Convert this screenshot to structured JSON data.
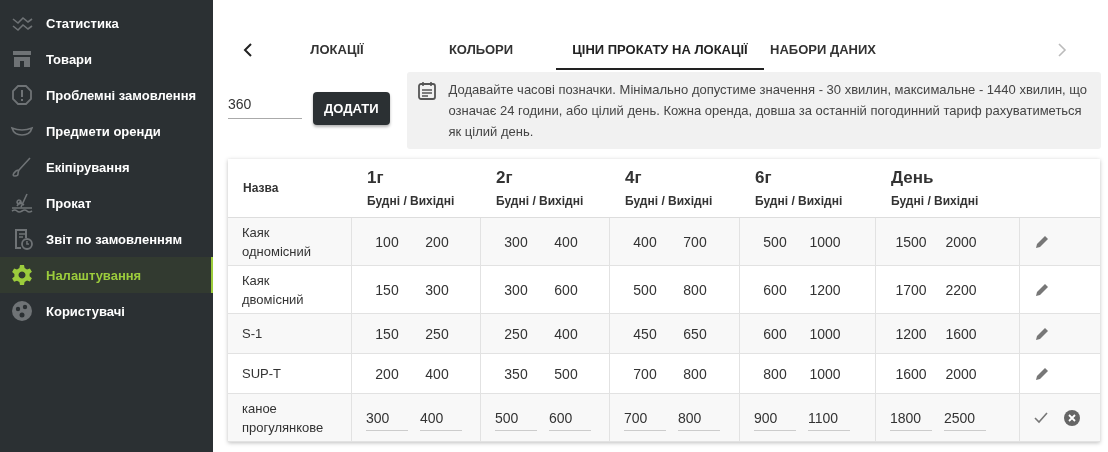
{
  "sidebar": {
    "items": [
      {
        "label": "Статистика",
        "kind": "chart",
        "selected": false
      },
      {
        "label": "Товари",
        "kind": "store",
        "selected": false
      },
      {
        "label": "Проблемні замовлення",
        "kind": "alert",
        "selected": false
      },
      {
        "label": "Предмети оренди",
        "kind": "boat",
        "selected": false
      },
      {
        "label": "Екіпірування",
        "kind": "paddle",
        "selected": false
      },
      {
        "label": "Прокат",
        "kind": "kayak",
        "selected": false
      },
      {
        "label": "Звіт по замовленням",
        "kind": "report",
        "selected": false
      },
      {
        "label": "Налаштування",
        "kind": "gear",
        "selected": true
      },
      {
        "label": "Користувачі",
        "kind": "users",
        "selected": false
      }
    ]
  },
  "tabs": [
    {
      "label": "ЛОКАЦІЇ",
      "selected": false
    },
    {
      "label": "КОЛЬОРИ",
      "selected": false
    },
    {
      "label": "ЦІНИ ПРОКАТУ НА ЛОКАЦІЇ",
      "selected": true
    },
    {
      "label": "НАБОРИ ДАНИХ",
      "selected": false
    }
  ],
  "add_form": {
    "value": "360",
    "button": "ДОДАТИ"
  },
  "info": "Додавайте часові позначки. Мінімально допустиме значення - 30 хвилин, максимальне - 1440 хвилин, що означає 24 години, або цілий день. Кожна оренда, довша за останній погодинний тариф рахуватиметься як цілий день.",
  "table": {
    "name_header": "Назва",
    "columns": [
      {
        "title": "1г",
        "subtitle": "Будні / Вихідні"
      },
      {
        "title": "2г",
        "subtitle": "Будні / Вихідні"
      },
      {
        "title": "4г",
        "subtitle": "Будні / Вихідні"
      },
      {
        "title": "6г",
        "subtitle": "Будні / Вихідні"
      },
      {
        "title": "День",
        "subtitle": "Будні / Вихідні"
      }
    ],
    "rows": [
      {
        "kind": "view",
        "name": "Каяк одномісний",
        "prices": [
          [
            "100",
            "200"
          ],
          [
            "300",
            "400"
          ],
          [
            "400",
            "700"
          ],
          [
            "500",
            "1000"
          ],
          [
            "1500",
            "2000"
          ]
        ]
      },
      {
        "kind": "view",
        "name": "Каяк двомісний",
        "prices": [
          [
            "150",
            "300"
          ],
          [
            "300",
            "600"
          ],
          [
            "500",
            "800"
          ],
          [
            "600",
            "1200"
          ],
          [
            "1700",
            "2200"
          ]
        ]
      },
      {
        "kind": "view",
        "name": "S-1",
        "prices": [
          [
            "150",
            "250"
          ],
          [
            "250",
            "400"
          ],
          [
            "450",
            "650"
          ],
          [
            "600",
            "1000"
          ],
          [
            "1200",
            "1600"
          ]
        ]
      },
      {
        "kind": "view",
        "name": "SUP-T",
        "prices": [
          [
            "200",
            "400"
          ],
          [
            "350",
            "500"
          ],
          [
            "700",
            "800"
          ],
          [
            "800",
            "1000"
          ],
          [
            "1600",
            "2000"
          ]
        ]
      },
      {
        "kind": "edit",
        "name": "каное прогулянкове",
        "prices": [
          [
            "300",
            "400"
          ],
          [
            "500",
            "600"
          ],
          [
            "700",
            "800"
          ],
          [
            "900",
            "1100"
          ],
          [
            "1800",
            "2500"
          ]
        ]
      }
    ]
  }
}
